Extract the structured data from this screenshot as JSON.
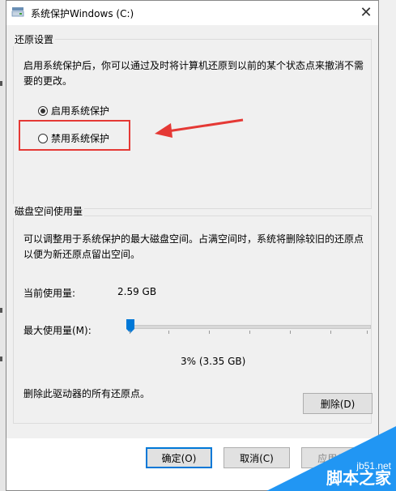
{
  "window": {
    "title": "系统保护Windows (C:)",
    "close_glyph": "✕"
  },
  "restore_settings": {
    "group_title": "还原设置",
    "description": "启用系统保护后，你可以通过及时将计算机还原到以前的某个状态点来撤消不需要的更改。",
    "options": [
      {
        "label": "启用系统保护",
        "selected": true
      },
      {
        "label": "禁用系统保护",
        "selected": false
      }
    ]
  },
  "disk_usage": {
    "group_title": "磁盘空间使用量",
    "description": "可以调整用于系统保护的最大磁盘空间。占满空间时，系统将删除较旧的还原点以便为新还原点留出空间。",
    "current_label": "当前使用量:",
    "current_value": "2.59 GB",
    "max_label": "最大使用量(M):",
    "slider_percent": 3,
    "slider_readout": "3% (3.35 GB)",
    "delete_description": "删除此驱动器的所有还原点。",
    "delete_button": "删除(D)"
  },
  "footer": {
    "ok_button": "确定(O)",
    "cancel_button": "取消(C)",
    "apply_button": "应用(A)"
  },
  "watermark": {
    "site": "jb51.net",
    "name": "脚本之家"
  },
  "colors": {
    "annotation_red": "#e53935",
    "slider_blue": "#0078d7",
    "watermark_blue": "#2196f3"
  },
  "icons": [
    "system-drive-icon",
    "close-icon",
    "red-arrow-annotation"
  ]
}
